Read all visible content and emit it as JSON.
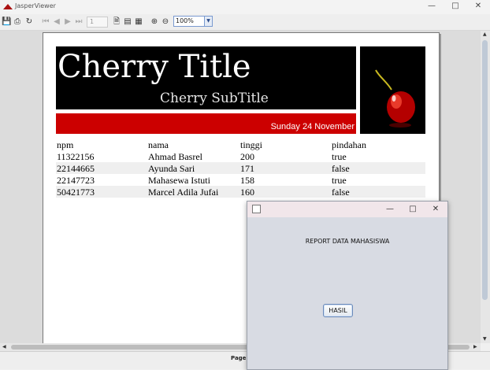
{
  "window": {
    "title": "JasperViewer",
    "accent": "#cc0000"
  },
  "toolbar": {
    "buttons": [
      "save-icon",
      "print-icon",
      "reload-icon",
      "first-page-icon",
      "previous-page-icon",
      "next-page-icon",
      "last-page-icon",
      "actual-size-icon",
      "fit-page-icon",
      "fit-width-icon",
      "zoom-in-icon",
      "zoom-out-icon"
    ],
    "page_number": "1",
    "zoom": "100%"
  },
  "report": {
    "title": "Cherry Title",
    "subtitle": "Cherry SubTitle",
    "date": "Sunday 24 November",
    "columns": [
      "npm",
      "nama",
      "tinggi",
      "pindahan"
    ],
    "rows": [
      [
        "11322156",
        "Ahmad Basrel",
        "200",
        "true"
      ],
      [
        "22144665",
        "Ayunda Sari",
        "171",
        "false"
      ],
      [
        "22147723",
        "Mahasewa Istuti",
        "158",
        "true"
      ],
      [
        "50421773",
        "Marcel Adila Jufai",
        "160",
        "false"
      ]
    ]
  },
  "statusbar": {
    "page_label": "Page 1"
  },
  "dialog": {
    "label": "REPORT DATA MAHASISWA",
    "button": "HASIL"
  }
}
